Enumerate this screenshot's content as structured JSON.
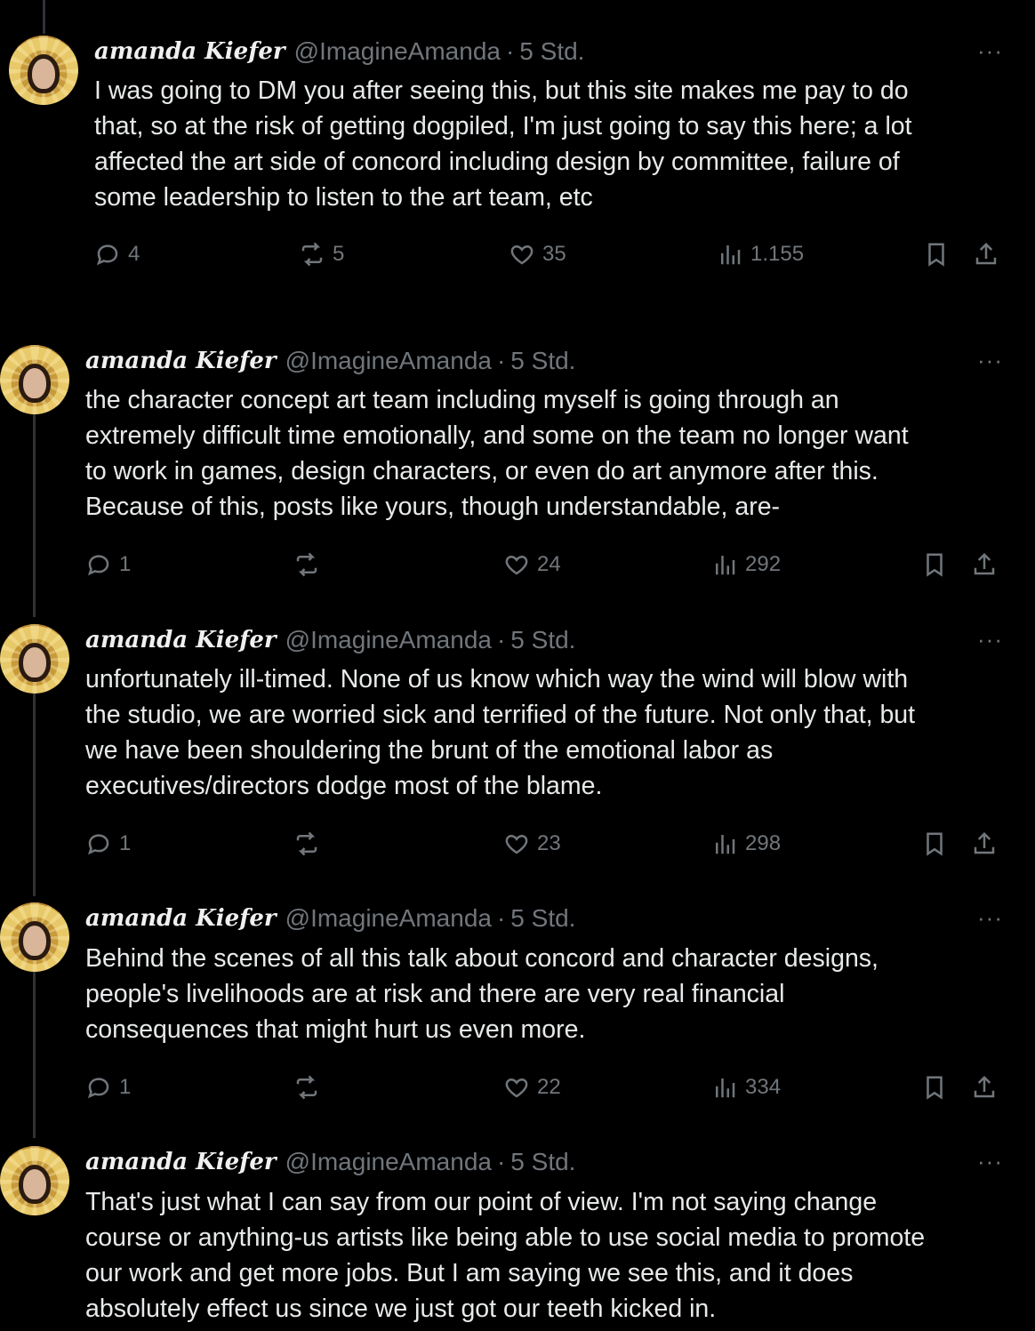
{
  "tweets": [
    {
      "display_name": "amanda Kiefer",
      "handle": "@ImagineAmanda",
      "separator": "·",
      "time": "5 Std.",
      "more": "···",
      "text": "I was going to DM you after seeing this, but this site makes me pay to do\nthat, so at the risk of getting dogpiled, I'm just going to say this here; a lot\naffected the art side of concord including design by committee, failure of\nsome leadership to listen to the art team, etc",
      "replies": "4",
      "reposts": "5",
      "likes": "35",
      "views": "1.155"
    },
    {
      "display_name": "amanda Kiefer",
      "handle": "@ImagineAmanda",
      "separator": "·",
      "time": "5 Std.",
      "more": "···",
      "text": "the character concept art team including myself is going through an\nextremely difficult time emotionally, and some on the team no longer want\nto work in games, design characters, or even do art anymore after this.\nBecause of this, posts like yours, though understandable, are-",
      "replies": "1",
      "reposts": "",
      "likes": "24",
      "views": "292"
    },
    {
      "display_name": "amanda Kiefer",
      "handle": "@ImagineAmanda",
      "separator": "·",
      "time": "5 Std.",
      "more": "···",
      "text": "unfortunately ill-timed.  None of us know which way the wind will blow with\nthe studio, we are worried sick and terrified of the future.  Not only that, but\nwe have been shouldering the brunt of the emotional labor as\nexecutives/directors dodge most of the blame.",
      "replies": "1",
      "reposts": "",
      "likes": "23",
      "views": "298"
    },
    {
      "display_name": "amanda Kiefer",
      "handle": "@ImagineAmanda",
      "separator": "·",
      "time": "5 Std.",
      "more": "···",
      "text": "Behind the scenes of all this talk about concord and character designs,\npeople's livelihoods are at risk and there are very real financial\nconsequences that might hurt us even more.",
      "replies": "1",
      "reposts": "",
      "likes": "22",
      "views": "334"
    },
    {
      "display_name": "amanda Kiefer",
      "handle": "@ImagineAmanda",
      "separator": "·",
      "time": "5 Std.",
      "more": "···",
      "text": "That's just what I can say from our point of view.  I'm not saying change\ncourse or anything-us artists like being able to use social media to promote\nour work and get more jobs.  But I am saying we see this, and it does\nabsolutely effect us since we just got our teeth kicked in."
    }
  ],
  "icons": {
    "reply": "reply-icon",
    "repost": "repost-icon",
    "like": "heart-icon",
    "views": "views-icon",
    "bookmark": "bookmark-icon",
    "share": "share-icon"
  },
  "colors": {
    "background": "#000000",
    "text": "#e7e9ea",
    "muted": "#71767b",
    "thread_line": "#2f3336"
  }
}
